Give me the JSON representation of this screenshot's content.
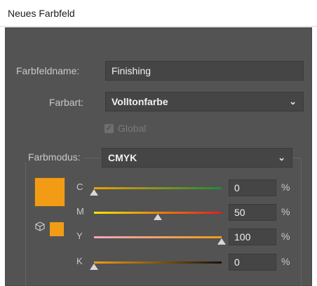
{
  "window": {
    "title": "Neues Farbfeld"
  },
  "form": {
    "name_label": "Farbfeldname:",
    "name_value": "Finishing",
    "type_label": "Farbart:",
    "type_value": "Volltonfarbe",
    "global_label": "Global",
    "global_checked": true,
    "mode_label": "Farbmodus:",
    "mode_value": "CMYK"
  },
  "color": {
    "swatch": "#f29c15"
  },
  "channels": [
    {
      "label": "C",
      "value": "0",
      "unit": "%",
      "level": 0,
      "gradient": [
        "#f0a000",
        "#1f8a3a"
      ]
    },
    {
      "label": "M",
      "value": "50",
      "unit": "%",
      "level": 0.5,
      "gradient": [
        "#f5e600",
        "#e02020"
      ]
    },
    {
      "label": "Y",
      "value": "100",
      "unit": "%",
      "level": 1,
      "gradient": [
        "#f0a7c0",
        "#f09a14"
      ]
    },
    {
      "label": "K",
      "value": "0",
      "unit": "%",
      "level": 0,
      "gradient": [
        "#f29c15",
        "#1a1208"
      ]
    }
  ],
  "icons": {
    "chevron": "chevron-down-icon",
    "cube": "cube-icon",
    "check": "checkmark-icon"
  }
}
